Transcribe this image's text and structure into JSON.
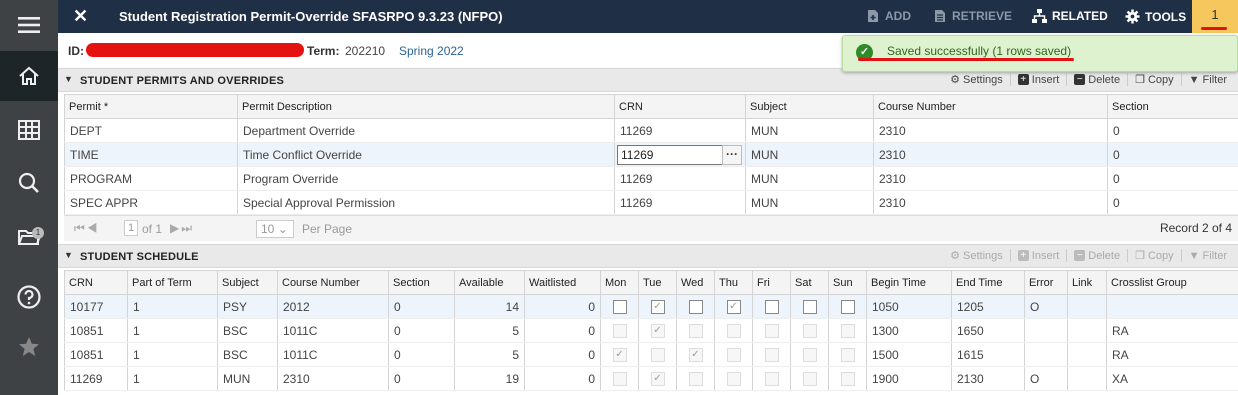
{
  "header": {
    "title": "Student Registration Permit-Override SFASRPO 9.3.23 (NFPO)",
    "add_label": "ADD",
    "retrieve_label": "RETRIEVE",
    "related_label": "RELATED",
    "tools_label": "TOOLS",
    "notification_count": "1"
  },
  "key_block": {
    "id_label": "ID:",
    "term_label": "Term:",
    "term_code": "202210",
    "term_desc": "Spring 2022"
  },
  "toast": {
    "message": "Saved successfully (1 rows saved)"
  },
  "permits": {
    "title": "STUDENT PERMITS AND OVERRIDES",
    "tools": [
      "Settings",
      "Insert",
      "Delete",
      "Copy",
      "Filter"
    ],
    "columns": [
      "Permit *",
      "Permit Description",
      "CRN",
      "Subject",
      "Course Number",
      "Section"
    ],
    "rows": [
      [
        "DEPT",
        "Department Override",
        "11269",
        "MUN",
        "2310",
        "0"
      ],
      [
        "TIME",
        "Time Conflict Override",
        "11269",
        "MUN",
        "2310",
        "0"
      ],
      [
        "PROGRAM",
        "Program Override",
        "11269",
        "MUN",
        "2310",
        "0"
      ],
      [
        "SPEC APPR",
        "Special Approval Permission",
        "11269",
        "MUN",
        "2310",
        "0"
      ]
    ],
    "pager": {
      "of_label": "of 1",
      "page": "1",
      "per_page_value": "10",
      "per_page_label": "Per Page",
      "record": "Record 2 of 4"
    }
  },
  "schedule": {
    "title": "STUDENT SCHEDULE",
    "tools": [
      "Settings",
      "Insert",
      "Delete",
      "Copy",
      "Filter"
    ],
    "columns": [
      "CRN",
      "Part of Term",
      "Subject",
      "Course Number",
      "Section",
      "Available",
      "Waitlisted",
      "Mon",
      "Tue",
      "Wed",
      "Thu",
      "Fri",
      "Sat",
      "Sun",
      "Begin Time",
      "End Time",
      "Error",
      "Link",
      "Crosslist Group"
    ],
    "rows": [
      {
        "crn": "10177",
        "pot": "1",
        "subj": "PSY",
        "crse": "2012",
        "sec": "0",
        "avail": "14",
        "wait": "0",
        "days": [
          false,
          true,
          false,
          true,
          false,
          false,
          false
        ],
        "begin": "1050",
        "end": "1205",
        "error": "O",
        "link": "",
        "xlst": ""
      },
      {
        "crn": "10851",
        "pot": "1",
        "subj": "BSC",
        "crse": "1011C",
        "sec": "0",
        "avail": "5",
        "wait": "0",
        "days": [
          false,
          true,
          false,
          false,
          false,
          false,
          false
        ],
        "begin": "1300",
        "end": "1650",
        "error": "",
        "link": "",
        "xlst": "RA"
      },
      {
        "crn": "10851",
        "pot": "1",
        "subj": "BSC",
        "crse": "1011C",
        "sec": "0",
        "avail": "5",
        "wait": "0",
        "days": [
          true,
          false,
          true,
          false,
          false,
          false,
          false
        ],
        "begin": "1500",
        "end": "1615",
        "error": "",
        "link": "",
        "xlst": "RA"
      },
      {
        "crn": "11269",
        "pot": "1",
        "subj": "MUN",
        "crse": "2310",
        "sec": "0",
        "avail": "19",
        "wait": "0",
        "days": [
          false,
          true,
          false,
          false,
          false,
          false,
          false
        ],
        "begin": "1900",
        "end": "2130",
        "error": "O",
        "link": "",
        "xlst": "XA"
      }
    ]
  },
  "colors": {
    "topbar": "#1f2f46",
    "sidebar": "#3f4245",
    "notification": "#f6c75c",
    "toast_bg": "#dff2d0",
    "link_blue": "#2a6496"
  }
}
